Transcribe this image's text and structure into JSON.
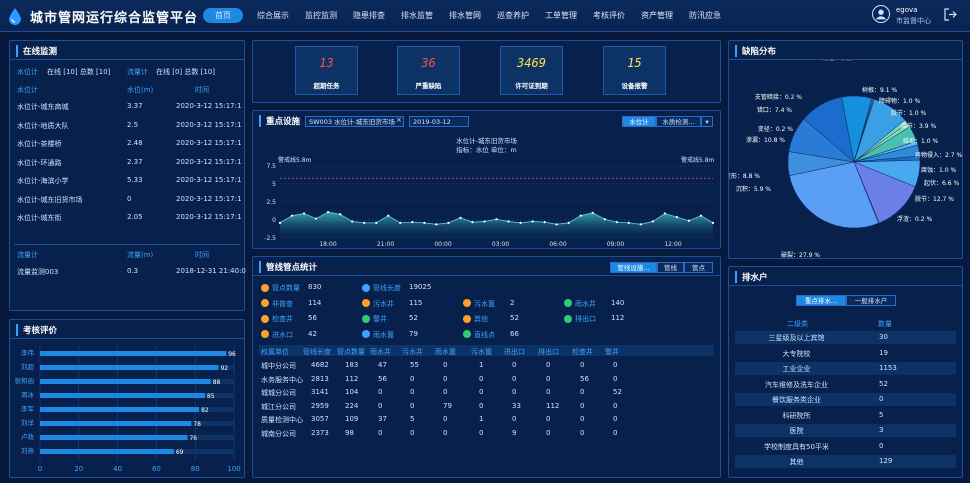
{
  "header": {
    "title": "城市管网运行综合监管平台",
    "nav": [
      "首页",
      "综合展示",
      "监控监测",
      "隐患排查",
      "排水监管",
      "排水管网",
      "巡查养护",
      "工单管理",
      "考核评价",
      "资产管理",
      "防汛应急"
    ],
    "user_name": "egova",
    "user_role": "市监督中心"
  },
  "monitor": {
    "title": "在线监测",
    "wl_label": "水位计",
    "wl_stats": "在线 [10] 总数 [10]",
    "fm_label": "流量计",
    "fm_stats": "在线 [0] 总数 [10]",
    "wl_headers": [
      "水位计",
      "水位(m)",
      "时间"
    ],
    "wl_rows": [
      [
        "水位计-城东商城",
        "3.37",
        "2020-3-12 15:17:1"
      ],
      [
        "水位计-地质大队",
        "2.5",
        "2020-3-12 15:17:1"
      ],
      [
        "水位计-茶楼桥",
        "2.48",
        "2020-3-12 15:17:1"
      ],
      [
        "水位计-环通路",
        "2.37",
        "2020-3-12 15:17:1"
      ],
      [
        "水位计-海滨小学",
        "5.33",
        "2020-3-12 15:17:1"
      ],
      [
        "水位计-城东旧货市场",
        "0",
        "2020-3-12 15:17:1"
      ],
      [
        "水位计-城东街",
        "2.05",
        "2020-3-12 15:17:1"
      ]
    ],
    "fm_headers": [
      "流量计",
      "流量(m)",
      "时间"
    ],
    "fm_rows": [
      [
        "流量监测003",
        "0.3",
        "2018-12-31 21:40:0"
      ]
    ]
  },
  "assess": {
    "title": "考核评价",
    "items": [
      {
        "name": "李伟",
        "score": 96
      },
      {
        "name": "刘超",
        "score": 92
      },
      {
        "name": "张和函",
        "score": 88
      },
      {
        "name": "周冰",
        "score": 85
      },
      {
        "name": "李军",
        "score": 82
      },
      {
        "name": "刘洋",
        "score": 78
      },
      {
        "name": "卢政",
        "score": 76
      },
      {
        "name": "刘燕",
        "score": 69
      }
    ],
    "axis": [
      "0",
      "20",
      "40",
      "60",
      "80",
      "100"
    ]
  },
  "kpis": [
    {
      "value": "13",
      "label": "超期任务",
      "color": "#ff4d4f"
    },
    {
      "value": "36",
      "label": "严重缺陷",
      "color": "#ff4d4f"
    },
    {
      "value": "3469",
      "label": "许可证到期",
      "color": "#ffe14d"
    },
    {
      "value": "15",
      "label": "设备报警",
      "color": "#ffe14d"
    }
  ],
  "keyfac": {
    "title": "重点设施",
    "device": "SW003 水位计-城东旧货市场",
    "date": "2019-03-12",
    "tab1": "水位计",
    "tab2": "水质检测...",
    "chart_title": "水位计-城东旧货市场",
    "chart_sub": "指标：水位 单位：m",
    "warn_left": "警戒线5.8m",
    "warn_right": "警戒线5.8m"
  },
  "chart_data": {
    "type": "area",
    "ylabel": "",
    "ylim": [
      -2.5,
      7.5
    ],
    "yticks": [
      "7.5",
      "5",
      "2.5",
      "0",
      "-2.5"
    ],
    "xticks": [
      "18:00",
      "21:00",
      "00:00",
      "03:00",
      "06:00",
      "09:00",
      "12:00"
    ],
    "warning_line": 5.8,
    "values": [
      -0.4,
      0.6,
      0.9,
      0.2,
      1.1,
      0.8,
      -0.2,
      -0.4,
      -0.4,
      0.6,
      -0.4,
      -0.3,
      -0.4,
      -0.6,
      -0.4,
      0.3,
      -0.3,
      -0.2,
      0.1,
      -0.2,
      -0.4,
      -0.2,
      -0.3,
      -0.6,
      -0.4,
      0.6,
      1.0,
      0.1,
      -0.3,
      -0.4,
      -0.6,
      -0.2,
      0.9,
      0.4,
      -0.1,
      0.6,
      -0.4
    ]
  },
  "pipe": {
    "title": "管线管点统计",
    "tabs": [
      "管线设施...",
      "管线",
      "管点"
    ],
    "stats": [
      {
        "label": "管点数量",
        "value": "830",
        "color": "#ff9f2e"
      },
      {
        "label": "管线长度",
        "value": "19025",
        "color": "#3fa2ff"
      },
      {
        "label": "非普查",
        "value": "114",
        "color": "#ff9f2e"
      },
      {
        "label": "污水井",
        "value": "115",
        "color": "#ff9f2e"
      },
      {
        "label": "污水篦",
        "value": "2",
        "color": "#ff9f2e"
      },
      {
        "label": "雨水井",
        "value": "140",
        "color": "#2ecc71"
      },
      {
        "label": "检查井",
        "value": "56",
        "color": "#ff9f2e"
      },
      {
        "label": "警井",
        "value": "52",
        "color": "#2ecc71"
      },
      {
        "label": "其他",
        "value": "52",
        "color": "#ff9f2e"
      },
      {
        "label": "排出口",
        "value": "112",
        "color": "#2ecc71"
      },
      {
        "label": "进水口",
        "value": "42",
        "color": "#ff9f2e"
      },
      {
        "label": "雨水篦",
        "value": "79",
        "color": "#3fa2ff"
      },
      {
        "label": "直线点",
        "value": "66",
        "color": "#2ecc71"
      }
    ],
    "headers": [
      "权属单位",
      "管线长度",
      "管点数量",
      "雨水井",
      "污水井",
      "雨水篦",
      "污水篦",
      "进出口",
      "排出口",
      "检查井",
      "警井"
    ],
    "rows": [
      [
        "城中分公司",
        "4682",
        "183",
        "47",
        "55",
        "0",
        "1",
        "0",
        "0",
        "0",
        "0"
      ],
      [
        "水务服务中心",
        "2813",
        "112",
        "56",
        "0",
        "0",
        "0",
        "0",
        "0",
        "56",
        "0"
      ],
      [
        "城城分公司",
        "3141",
        "104",
        "0",
        "0",
        "0",
        "0",
        "0",
        "0",
        "0",
        "52"
      ],
      [
        "城江分公司",
        "2959",
        "224",
        "0",
        "0",
        "79",
        "0",
        "33",
        "112",
        "0",
        "0"
      ],
      [
        "质量检测中心",
        "3057",
        "109",
        "37",
        "5",
        "0",
        "1",
        "0",
        "0",
        "0",
        "0"
      ],
      [
        "城南分公司",
        "2373",
        "98",
        "0",
        "0",
        "0",
        "0",
        "9",
        "0",
        "0",
        "0"
      ]
    ]
  },
  "defect": {
    "title": "缺陷分布"
  },
  "pie": {
    "slices": [
      {
        "label": "残墙、坝根：0.2 %",
        "value": 0.2,
        "color": "#6fd4ff"
      },
      {
        "label": "树根：9.1 %",
        "value": 9.1,
        "color": "#3aa0e6"
      },
      {
        "label": "障碍物：1.0 %",
        "value": 1.0,
        "color": "#7fdcc8"
      },
      {
        "label": "胶节：1.0 %",
        "value": 1.0,
        "color": "#88e0b0"
      },
      {
        "label": "腐节：3.9 %",
        "value": 3.9,
        "color": "#49c0b0"
      },
      {
        "label": "结垢：1.0 %",
        "value": 1.0,
        "color": "#5ab0ff"
      },
      {
        "label": "异物侵入：2.7 %",
        "value": 2.7,
        "color": "#2d8bd8"
      },
      {
        "label": "腐蚀：1.0 %",
        "value": 1.0,
        "color": "#1f6fc0"
      },
      {
        "label": "起伏：6.6 %",
        "value": 6.6,
        "color": "#4aa8f0"
      },
      {
        "label": "脱节：12.7 %",
        "value": 12.7,
        "color": "#6b7fe8"
      },
      {
        "label": "浮渣：0.2 %",
        "value": 0.2,
        "color": "#8aa0f0"
      },
      {
        "label": "破裂：27.9 %",
        "value": 27.9,
        "color": "#5a9ff5"
      },
      {
        "label": "沉积：5.9 %",
        "value": 5.9,
        "color": "#3f8fe0"
      },
      {
        "label": "变形：8.8 %",
        "value": 8.8,
        "color": "#2a7bd6"
      },
      {
        "label": "渗漏：10.8 %",
        "value": 10.8,
        "color": "#1b6ccc"
      },
      {
        "label": "错口：7.4 %",
        "value": 7.4,
        "color": "#1590e0"
      },
      {
        "label": "支管暗接：0.2 %",
        "value": 0.2,
        "color": "#57c6e8"
      },
      {
        "label": "变径：0.2 %",
        "value": 0.2,
        "color": "#8de0f0"
      }
    ]
  },
  "drain": {
    "title": "排水户",
    "tab1": "重点排水...",
    "tab2": "一般排水户",
    "headers": [
      "二级类",
      "数量"
    ],
    "rows": [
      [
        "三星级及以上宾馆",
        "30"
      ],
      [
        "大专院校",
        "19"
      ],
      [
        "工业企业",
        "1153"
      ],
      [
        "汽车维修及洗车企业",
        "52"
      ],
      [
        "餐饮服务类企业",
        "0"
      ],
      [
        "科研院所",
        "5"
      ],
      [
        "医院",
        "3"
      ],
      [
        "学校制度具有50平米",
        "0"
      ],
      [
        "其他",
        "129"
      ]
    ]
  }
}
